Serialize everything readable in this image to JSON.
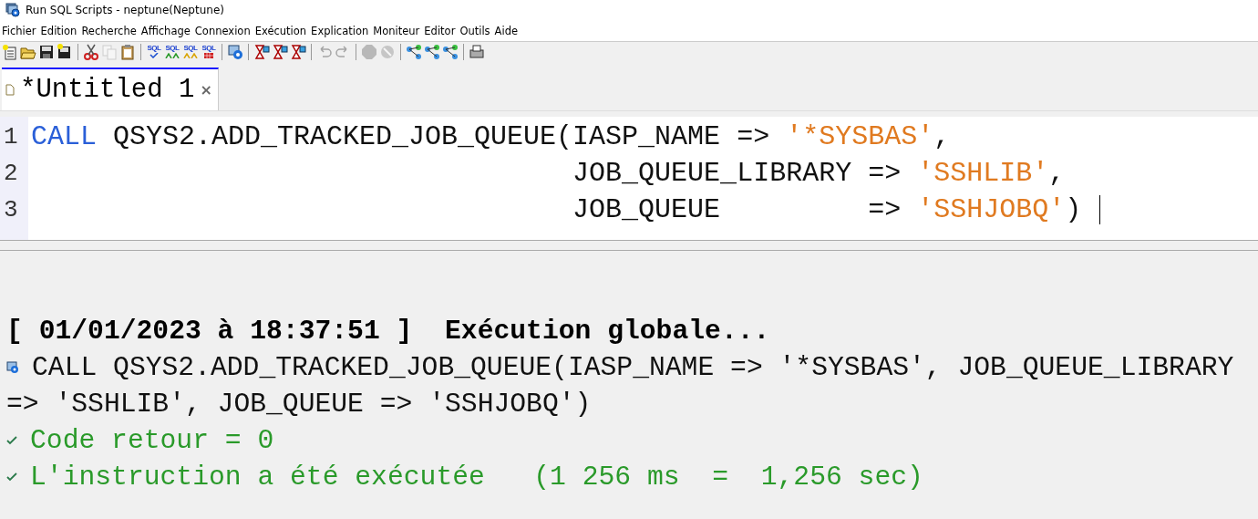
{
  "window": {
    "title": "Run SQL Scripts - neptune(Neptune)"
  },
  "menu": [
    "Fichier",
    "Edition",
    "Recherche",
    "Affichage",
    "Connexion",
    "Exécution",
    "Explication",
    "Moniteur",
    "Editor",
    "Outils",
    "Aide"
  ],
  "toolbar": [
    [
      {
        "kind": "new",
        "disabled": false
      },
      {
        "kind": "open",
        "disabled": false
      },
      {
        "kind": "save",
        "disabled": false
      },
      {
        "kind": "saveas",
        "disabled": false
      }
    ],
    [
      {
        "kind": "cut",
        "disabled": false
      },
      {
        "kind": "copy",
        "disabled": true
      },
      {
        "kind": "paste",
        "disabled": false
      }
    ],
    [
      {
        "kind": "sql",
        "label": "SQL",
        "disabled": false
      },
      {
        "kind": "sql",
        "label": "SQL",
        "disabled": false
      },
      {
        "kind": "sql",
        "label": "SQL",
        "disabled": false
      },
      {
        "kind": "sql",
        "label": "SQL",
        "disabled": false
      }
    ],
    [
      {
        "kind": "connect",
        "disabled": false
      }
    ],
    [
      {
        "kind": "hourglass",
        "disabled": false
      },
      {
        "kind": "hourglass",
        "disabled": false
      },
      {
        "kind": "hourglass",
        "disabled": false
      }
    ],
    [
      {
        "kind": "undo",
        "disabled": true
      },
      {
        "kind": "redo",
        "disabled": true
      }
    ],
    [
      {
        "kind": "stop",
        "disabled": true
      },
      {
        "kind": "cancel",
        "disabled": true
      }
    ],
    [
      {
        "kind": "explain",
        "disabled": false
      },
      {
        "kind": "explain",
        "disabled": false
      },
      {
        "kind": "explain",
        "disabled": false
      }
    ],
    [
      {
        "kind": "print",
        "disabled": false
      }
    ]
  ],
  "tabs": [
    {
      "label": "*Untitled 1",
      "close": "×",
      "selected": true
    }
  ],
  "editor": {
    "lines": [
      {
        "number": "1",
        "cursor": false,
        "tokens": [
          {
            "kind": "keyword",
            "text": "CALL"
          },
          {
            "kind": "plain",
            "text": " QSYS2.ADD_TRACKED_JOB_QUEUE(IASP_NAME => "
          },
          {
            "kind": "string",
            "text": "'*SYSBAS'"
          },
          {
            "kind": "plain",
            "text": ","
          }
        ]
      },
      {
        "number": "2",
        "cursor": false,
        "tokens": [
          {
            "kind": "plain",
            "text": "                                 JOB_QUEUE_LIBRARY => "
          },
          {
            "kind": "string",
            "text": "'SSHLIB'"
          },
          {
            "kind": "plain",
            "text": ","
          }
        ]
      },
      {
        "number": "3",
        "cursor": true,
        "tokens": [
          {
            "kind": "plain",
            "text": "                                 JOB_QUEUE         => "
          },
          {
            "kind": "string",
            "text": "'SSHJOBQ'"
          },
          {
            "kind": "plain",
            "text": ")"
          }
        ]
      }
    ]
  },
  "output": [
    {
      "kind": "header",
      "lines": [
        "[ 01/01/2023 à 18:37:51 ]  Exécution globale..."
      ]
    },
    {
      "kind": "statement",
      "lines": [
        "CALL QSYS2.ADD_TRACKED_JOB_QUEUE(IASP_NAME => '*SYSBAS', JOB_QUEUE_LIBRARY",
        "=> 'SSHLIB', JOB_QUEUE => 'SSHJOBQ')"
      ]
    },
    {
      "kind": "success",
      "lines": [
        "Code retour = 0"
      ]
    },
    {
      "kind": "success",
      "lines": [
        "L'instruction a été exécutée   (1 256 ms  =  1,256 sec)"
      ]
    }
  ]
}
